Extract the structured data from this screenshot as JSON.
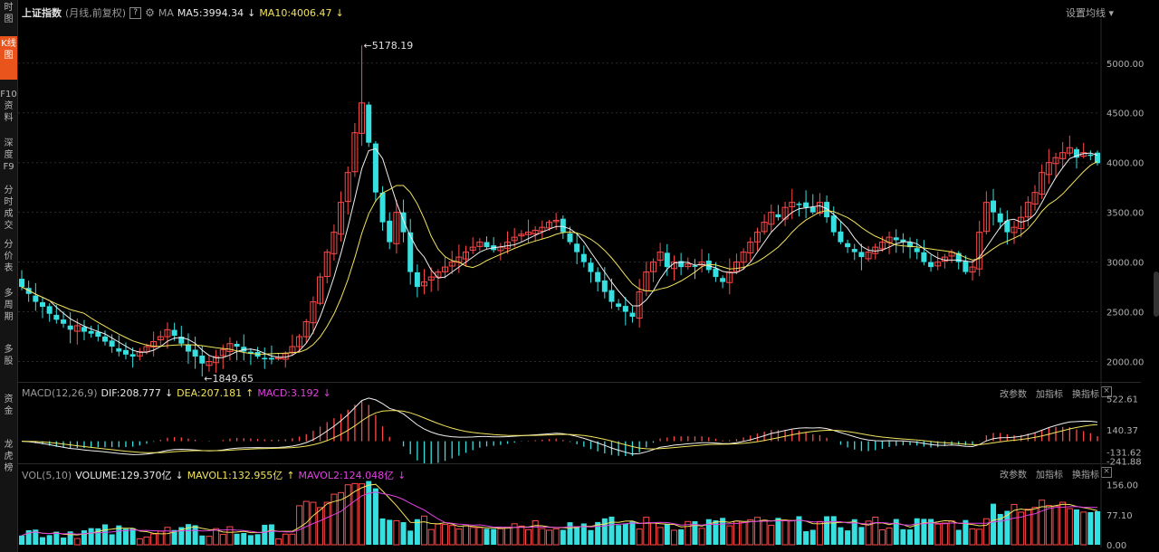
{
  "sidebar": {
    "tabs": [
      {
        "label": "时图",
        "active": false
      },
      {
        "label": "K线图",
        "active": true
      },
      {
        "label": "F10资料",
        "active": false
      },
      {
        "label": "深度F9",
        "active": false
      },
      {
        "label": "分时成交",
        "active": false
      },
      {
        "label": "分价表",
        "active": false
      },
      {
        "label": "多周期",
        "active": false
      },
      {
        "label": "多股",
        "active": false
      },
      {
        "label": "资金",
        "active": false
      },
      {
        "label": "龙虎榜",
        "active": false
      }
    ]
  },
  "price_pane": {
    "title": "上证指数",
    "subtitle": "(月线,前复权)",
    "help": "?",
    "ma_label": "MA",
    "ma5": "MA5:3994.34",
    "ma10": "MA10:4006.47",
    "ma5_arrow": "↓",
    "ma10_arrow": "↓",
    "settings": "设置均线",
    "high_label": "5178.19",
    "low_label": "1849.65",
    "y_ticks": [
      "5000.00",
      "4500.00",
      "4000.00",
      "3500.00",
      "3000.00",
      "2500.00",
      "2000.00"
    ]
  },
  "macd_pane": {
    "title": "MACD(12,26,9)",
    "dif": "DIF:208.777",
    "dif_arrow": "↓",
    "dea": "DEA:207.181",
    "dea_arrow": "↑",
    "macd": "MACD:3.192",
    "macd_arrow": "↓",
    "btn_params": "改参数",
    "btn_add": "加指标",
    "btn_switch": "换指标",
    "close": "×",
    "y_ticks": [
      "522.61",
      "140.37",
      "-131.62",
      "-241.88"
    ]
  },
  "vol_pane": {
    "title": "VOL(5,10)",
    "volume": "VOLUME:129.370亿",
    "volume_arrow": "↓",
    "mavol1": "MAVOL1:132.955亿",
    "mavol1_arrow": "↑",
    "mavol2": "MAVOL2:124.048亿",
    "mavol2_arrow": "↓",
    "btn_params": "改参数",
    "btn_add": "加指标",
    "btn_switch": "换指标",
    "close": "×",
    "y_ticks": [
      "156.00",
      "77.10",
      "0.00"
    ]
  },
  "colors": {
    "up_candle": "#ff4a4a",
    "down_candle": "#37e0e0",
    "ma5": "#f0f0f0",
    "ma10": "#f2e35b",
    "mavol2": "#e041e0"
  },
  "chart_data": {
    "type": "candlestick",
    "price_ylim": [
      1850,
      5180
    ],
    "close_series": [
      2750,
      2680,
      2600,
      2550,
      2480,
      2420,
      2380,
      2320,
      2360,
      2300,
      2280,
      2250,
      2200,
      2150,
      2100,
      2070,
      2050,
      2100,
      2150,
      2200,
      2250,
      2320,
      2260,
      2180,
      2100,
      2050,
      1980,
      2000,
      2050,
      2120,
      2180,
      2150,
      2100,
      2080,
      2050,
      2030,
      2020,
      2040,
      2080,
      2150,
      2250,
      2400,
      2600,
      2850,
      3100,
      3300,
      3600,
      3900,
      4300,
      4600,
      4200,
      3700,
      3400,
      3200,
      3500,
      3300,
      2900,
      2750,
      2800,
      2850,
      2900,
      2950,
      3000,
      3050,
      3100,
      3150,
      3200,
      3150,
      3120,
      3150,
      3200,
      3250,
      3280,
      3300,
      3320,
      3350,
      3400,
      3420,
      3300,
      3200,
      3100,
      3000,
      2900,
      2800,
      2700,
      2600,
      2550,
      2500,
      2450,
      2700,
      2900,
      3000,
      3100,
      2950,
      3000,
      2950,
      2980,
      2960,
      3000,
      2920,
      2850,
      2800,
      2900,
      3000,
      3100,
      3200,
      3300,
      3400,
      3500,
      3450,
      3550,
      3600,
      3580,
      3550,
      3500,
      3600,
      3450,
      3300,
      3200,
      3150,
      3100,
      3050,
      3100,
      3150,
      3200,
      3250,
      3220,
      3200,
      3150,
      3100,
      3000,
      2950,
      3000,
      3050,
      3100,
      3000,
      2900,
      2950,
      3300,
      3600,
      3500,
      3400,
      3300,
      3350,
      3450,
      3600,
      3700,
      3900,
      4000,
      4050,
      4100,
      4150,
      4050,
      4100,
      4080,
      3994
    ]
  }
}
